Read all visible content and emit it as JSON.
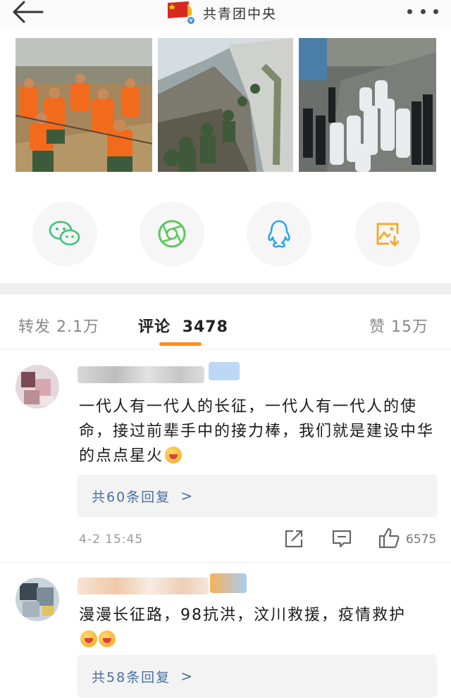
{
  "header": {
    "title": "共青团中央",
    "back_icon": "back-arrow-icon",
    "more_icon": "more-dots-icon"
  },
  "photos": [
    {
      "name": "flood-rescue-photo"
    },
    {
      "name": "earthquake-rescue-photo"
    },
    {
      "name": "epidemic-response-photo"
    }
  ],
  "share": [
    {
      "icon": "wechat-icon",
      "color": "#3ec27c"
    },
    {
      "icon": "moments-icon",
      "color": "#5ac85a"
    },
    {
      "icon": "qq-icon",
      "color": "#2aa8e8"
    },
    {
      "icon": "save-image-icon",
      "color": "#f5a623"
    }
  ],
  "tabs": {
    "repost": "转发 2.1万",
    "comments_label": "评论",
    "comments_count": "3478",
    "likes": "赞  15万"
  },
  "comments": [
    {
      "text": "一代人有一代人的长征，一代人有一代人的使命，接过前辈手中的接力棒，我们就是建设中华的点点星火",
      "replies": "共60条回复",
      "time": "4-2 15:45",
      "likes": "6575"
    },
    {
      "text": "漫漫长征路，98抗洪，汶川救援，疫情救护",
      "replies": "共58条回复"
    }
  ],
  "accent": "#ff8c1a",
  "link_color": "#4a6fa5"
}
